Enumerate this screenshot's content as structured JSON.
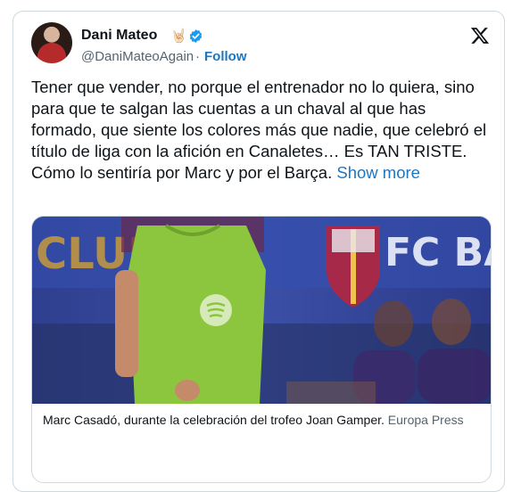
{
  "author": {
    "name": "Dani Mateo",
    "handle": "@DaniMateoAgain",
    "follow_label": "Follow",
    "separator": "·",
    "emoji": "🤘🏻"
  },
  "icons": {
    "verified": "verified-badge-icon",
    "platform": "x-logo-icon"
  },
  "tweet": {
    "text": "Tener que vender, no porque el entrenador no lo quiera, sino para que te salgan las cuentas a un chaval al que has formado, que siente los colores más que nadie, que celebró el título de liga con la afición en Canaletes… Es TAN TRISTE. Cómo lo sentiría por Marc y por el Barça.",
    "show_more": "Show more"
  },
  "media": {
    "banner_left": "CLUB",
    "banner_right": "FC BAR",
    "caption": "Marc Casadó, durante la celebración del trofeo Joan Gamper.",
    "caption_source": "Europa Press"
  },
  "colors": {
    "link": "#1d76c2",
    "verified": "#1d9bf0",
    "text": "#0f1419",
    "muted": "#536471"
  }
}
